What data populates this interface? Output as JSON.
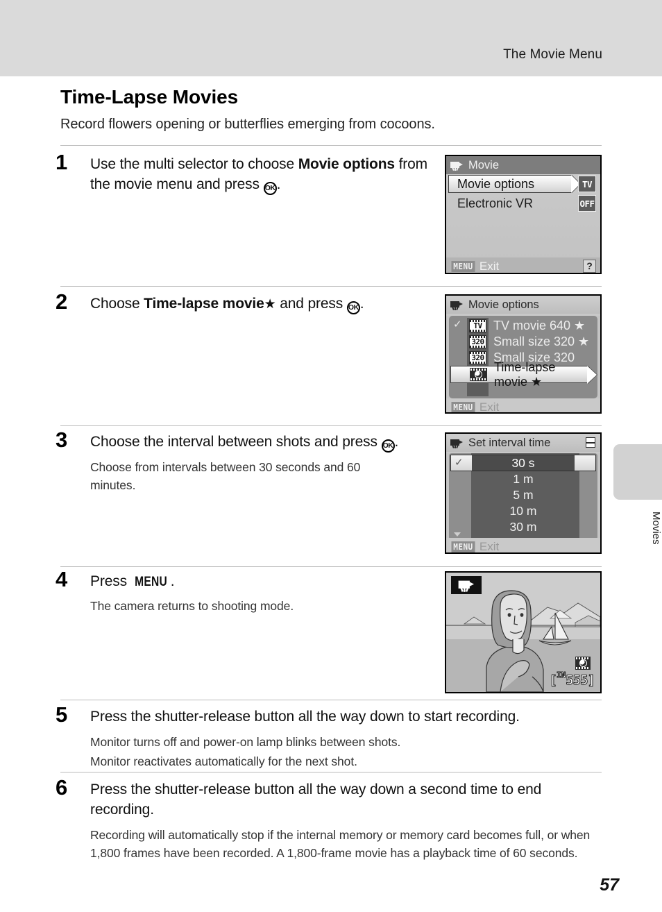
{
  "header": {
    "running_title": "The Movie Menu"
  },
  "section": {
    "title": "Time-Lapse Movies",
    "subtitle": "Record flowers opening or butterflies emerging from cocoons."
  },
  "steps": [
    {
      "number": "1",
      "head_parts": [
        "Use the multi selector to choose ",
        "Movie options",
        " from the movie menu and press ",
        "OK",
        "."
      ],
      "head_plain": "Use the multi selector to choose Movie options from the movie menu and press OK.",
      "notes": []
    },
    {
      "number": "2",
      "head_plain": "Choose Time-lapse movie ★ and press OK.",
      "notes": []
    },
    {
      "number": "3",
      "head_plain": "Choose the interval between shots and press OK.",
      "notes": [
        "Choose from intervals between 30 seconds and 60 minutes."
      ]
    },
    {
      "number": "4",
      "head_plain": "Press MENU.",
      "notes": [
        "The camera returns to shooting mode."
      ]
    },
    {
      "number": "5",
      "head_plain": "Press the shutter-release button all the way down to start recording.",
      "notes": [
        "Monitor turns off and power-on lamp blinks between shots.",
        "Monitor reactivates automatically for the next shot."
      ]
    },
    {
      "number": "6",
      "head_plain": "Press the shutter-release button all the way down a second time to end recording.",
      "notes": [
        "Recording will automatically stop if the internal memory or memory card becomes full, or when 1,800 frames have been recorded. A 1,800-frame movie has a playback time of 60 seconds."
      ]
    }
  ],
  "step_text": {
    "s1_a": "Use the multi selector to choose ",
    "s1_b": "Movie options",
    "s1_c": " from the movie menu and press ",
    "s1_d": ".",
    "s2_a": "Choose ",
    "s2_b": "Time-lapse movie",
    "s2_star": "★",
    "s2_c": " and press ",
    "s2_d": ".",
    "s3_a": "Choose the interval between shots and press ",
    "s3_d": ".",
    "s3_note": "Choose from intervals between 30 seconds and 60 minutes.",
    "s4_a": "Press ",
    "s4_menu": "MENU",
    "s4_d": ".",
    "s4_note": "The camera returns to shooting mode.",
    "s5_head": "Press the shutter-release button all the way down to start recording.",
    "s5_note1": "Monitor turns off and power-on lamp blinks between shots.",
    "s5_note2": "Monitor reactivates automatically for the next shot.",
    "s6_head": "Press the shutter-release button all the way down a second time to end recording.",
    "s6_note": "Recording will automatically stop if the internal memory or memory card becomes full, or when 1,800 frames have been recorded. A 1,800-frame movie has a playback time of 60 seconds."
  },
  "ok_button_label": "OK",
  "screens": {
    "movie_menu": {
      "title": "Movie",
      "rows": [
        {
          "label": "Movie options",
          "badge": "TV",
          "selected": true
        },
        {
          "label": "Electronic VR",
          "badge": "OFF",
          "selected": false
        }
      ],
      "footer": {
        "chip": "MENU",
        "text": "Exit",
        "help": "?"
      }
    },
    "movie_options": {
      "title": "Movie options",
      "items": [
        {
          "label": "TV movie 640 ★",
          "icon": "TV",
          "selected": false
        },
        {
          "label": "Small size 320 ★",
          "icon": "320",
          "selected": false
        },
        {
          "label": "Small size 320",
          "icon": "320",
          "selected": false
        },
        {
          "label": "Time-lapse movie ★",
          "icon": "time-lapse",
          "selected": true
        }
      ],
      "footer": {
        "chip": "MENU",
        "text": "Exit"
      }
    },
    "set_interval": {
      "title": "Set interval time",
      "selected_value": "30 s",
      "items": [
        "1 m",
        "5 m",
        "10 m",
        "30 m"
      ],
      "footer": {
        "chip": "MENU",
        "text": "Exit"
      }
    },
    "shooting": {
      "mode_icon": "movie-camera-icon",
      "frames_prefix": "IN",
      "frames_remaining": "555"
    }
  },
  "side_tab": {
    "label": "Movies"
  },
  "page_number": "57"
}
